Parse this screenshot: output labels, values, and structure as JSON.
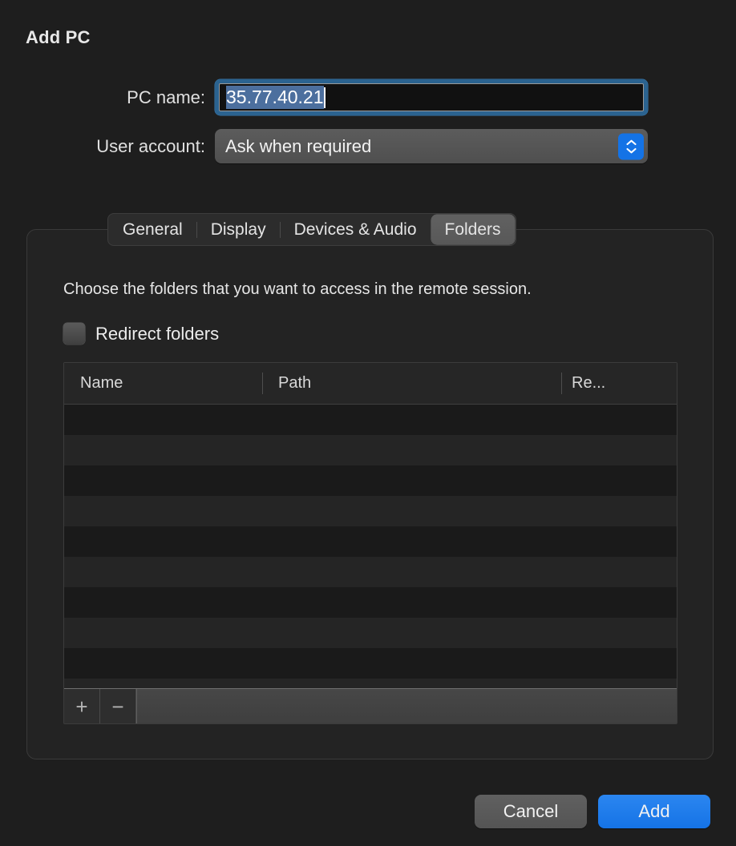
{
  "dialog": {
    "title": "Add PC"
  },
  "form": {
    "pc_name": {
      "label": "PC name:",
      "value": "35.77.40.21",
      "placeholder": "",
      "selected": true,
      "focus_ring_color": "#2b6390",
      "selection_color": "#4c6f9e"
    },
    "user_account": {
      "label": "User account:",
      "value": "Ask when required",
      "options": [
        "Ask when required"
      ],
      "stepper_color": "#1473e6"
    }
  },
  "tabs": [
    {
      "label": "General",
      "active": false
    },
    {
      "label": "Display",
      "active": false
    },
    {
      "label": "Devices & Audio",
      "active": false
    },
    {
      "label": "Folders",
      "active": true
    }
  ],
  "folders_pane": {
    "description": "Choose the folders that you want to access in the remote session.",
    "redirect_checkbox": {
      "label": "Redirect folders",
      "checked": false
    },
    "table": {
      "columns": [
        "Name",
        "Path",
        "Re..."
      ],
      "rows": [],
      "empty_row_count": 10,
      "toolbar": {
        "add_glyph": "+",
        "remove_glyph": "−"
      }
    }
  },
  "footer": {
    "cancel_label": "Cancel",
    "add_label": "Add",
    "default_button_color": "#1573e6"
  }
}
